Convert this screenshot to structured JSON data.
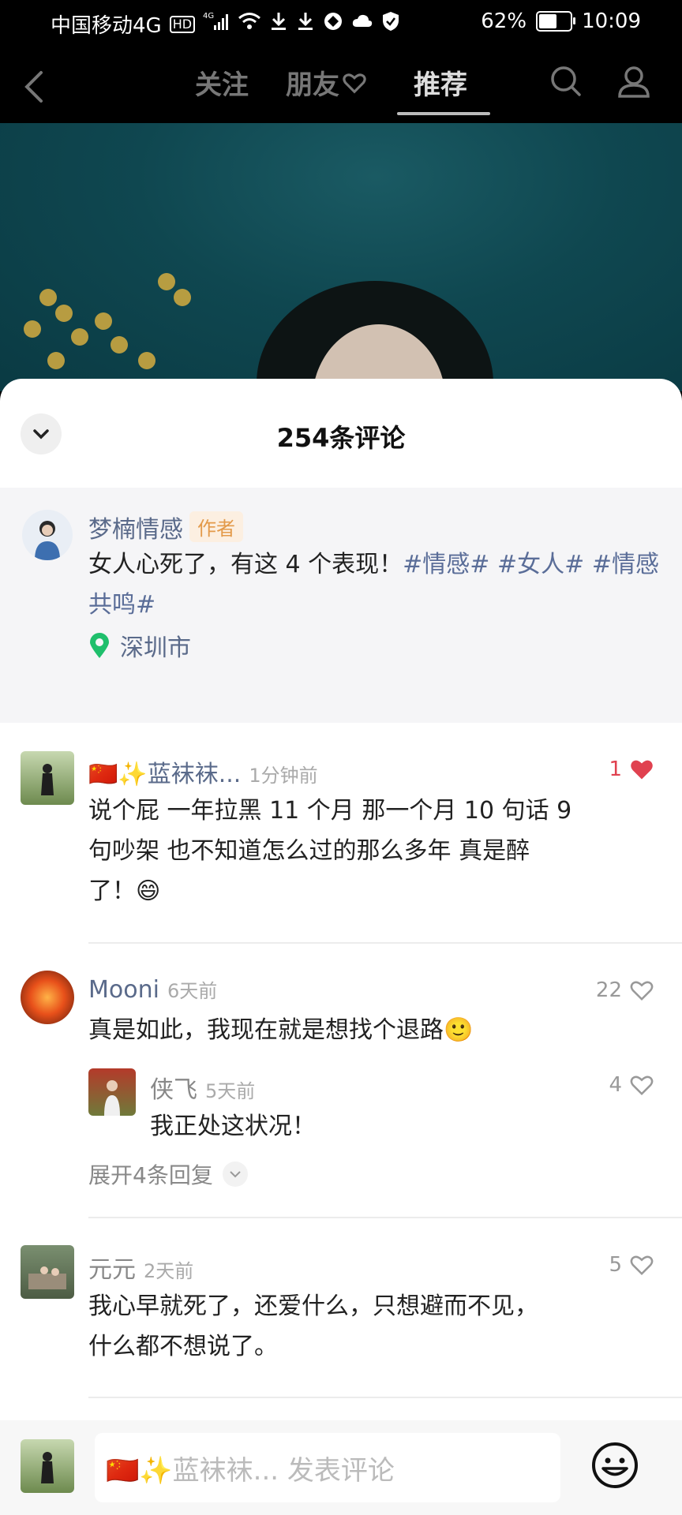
{
  "status_bar": {
    "carrier": "中国移动4G",
    "hd": "HD",
    "net": "4G",
    "battery": "62%",
    "battery_level": 0.62,
    "time": "10:09"
  },
  "nav": {
    "tabs": [
      "关注",
      "朋友",
      "推荐"
    ],
    "active_tab": "推荐"
  },
  "comments_panel": {
    "title": "254条评论",
    "author_post": {
      "author": "梦楠情感",
      "badge": "作者",
      "text_plain": "女人心死了，有这 4 个表现！",
      "tags_line1": [
        "#情感#",
        "#女人#",
        "#情感"
      ],
      "tags_line2": "共鸣#",
      "location": "深圳市"
    },
    "comments": [
      {
        "user": "🇨🇳✨蓝袜袜...",
        "time": "1分钟前",
        "likes": "1",
        "liked": true,
        "lines": [
          "说个屁 一年拉黑 11 个月 那一个月 10 句话 9",
          "句吵架 也不知道怎么过的那么多年 真是醉",
          "了！😄"
        ]
      },
      {
        "user": "Mooni",
        "time": "6天前",
        "likes": "22",
        "liked": false,
        "lines": [
          "真是如此，我现在就是想找个退路🙂"
        ],
        "reply": {
          "user": "侠飞",
          "time": "5天前",
          "likes": "4",
          "text": "我正处这状况！"
        },
        "expand_label": "展开4条回复"
      },
      {
        "user": "元元",
        "time": "2天前",
        "likes": "5",
        "liked": false,
        "lines": [
          "我心早就死了，还爱什么，只想避而不见，",
          "什么都不想说了。"
        ]
      }
    ]
  },
  "bottom_bar": {
    "placeholder": "🇨🇳✨蓝袜袜... 发表评论"
  },
  "colors": {
    "accent_like": "#e0414f",
    "name_color": "#5a6a8a",
    "location_pin": "#1fbf6c",
    "author_badge": "#e39a4a"
  }
}
